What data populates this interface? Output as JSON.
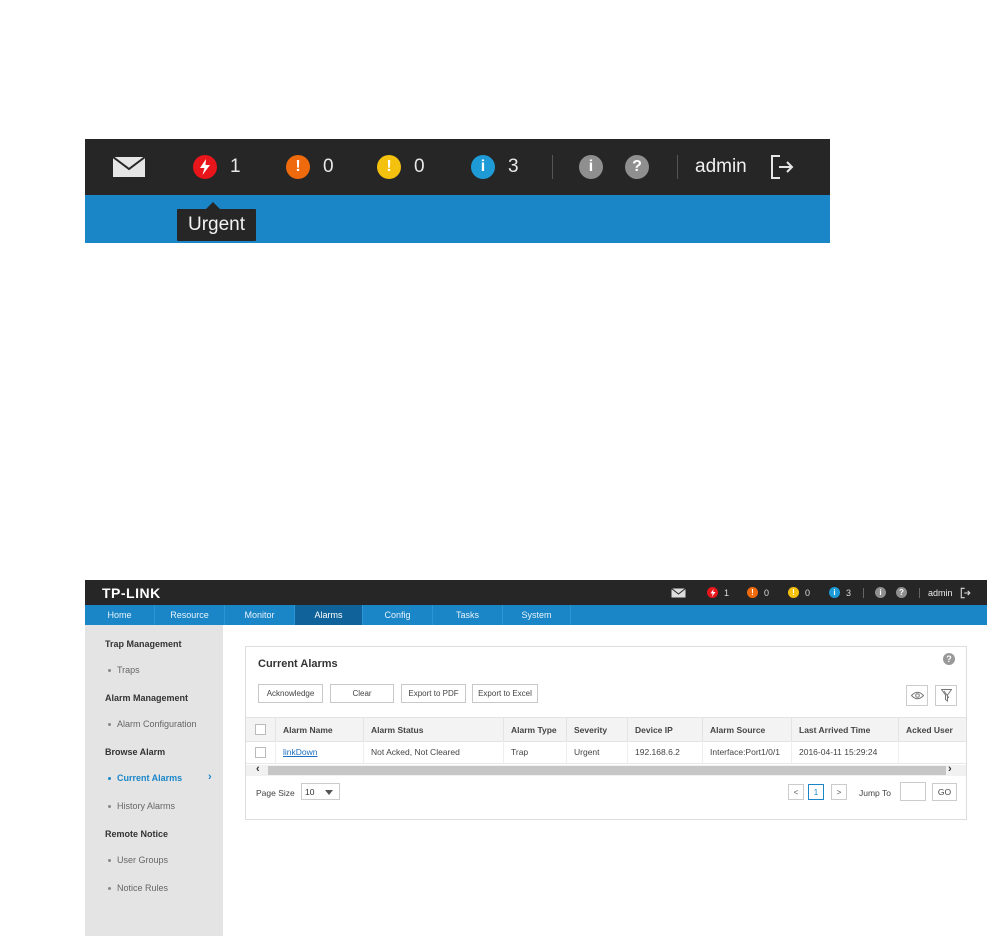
{
  "zoom": {
    "counts": {
      "urgent": "1",
      "major": "0",
      "minor": "0",
      "info": "3"
    },
    "user": "admin",
    "tooltip": "Urgent",
    "colors": {
      "urgent": "#e8151b",
      "major": "#ef6a0c",
      "minor": "#f4c10f",
      "info": "#1e9bd7",
      "neutral": "#8f8f8f"
    }
  },
  "app": {
    "logo": "TP-LINK",
    "counts": {
      "urgent": "1",
      "major": "0",
      "minor": "0",
      "info": "3"
    },
    "user": "admin",
    "nav": [
      "Home",
      "Resource",
      "Monitor",
      "Alarms",
      "Config",
      "Tasks",
      "System"
    ],
    "active_nav": "Alarms",
    "sidebar": {
      "groups": [
        {
          "title": "Trap Management",
          "items": [
            "Traps"
          ]
        },
        {
          "title": "Alarm Management",
          "items": [
            "Alarm Configuration"
          ]
        },
        {
          "title": "Browse Alarm",
          "items": [
            "Current Alarms",
            "History Alarms"
          ]
        },
        {
          "title": "Remote Notice",
          "items": [
            "User Groups",
            "Notice Rules"
          ]
        }
      ],
      "active_item": "Current Alarms"
    },
    "panel": {
      "title": "Current Alarms",
      "buttons": {
        "acknowledge": "Acknowledge",
        "clear": "Clear",
        "export_pdf": "Export to PDF",
        "export_excel": "Export to Excel"
      },
      "columns": [
        "Alarm Name",
        "Alarm Status",
        "Alarm Type",
        "Severity",
        "Device IP",
        "Alarm Source",
        "Last Arrived Time",
        "Acked User"
      ],
      "rows": [
        {
          "name": "linkDown",
          "status": "Not Acked, Not Cleared",
          "type": "Trap",
          "severity": "Urgent",
          "ip": "192.168.6.2",
          "source": "Interface:Port1/0/1",
          "time": "2016-04-11 15:29:24",
          "acked_user": ""
        }
      ],
      "pagination": {
        "page_size_label": "Page Size",
        "page_size": "10",
        "prev": "<",
        "current_page": "1",
        "next": ">",
        "jump_label": "Jump To",
        "go": "GO"
      }
    }
  }
}
